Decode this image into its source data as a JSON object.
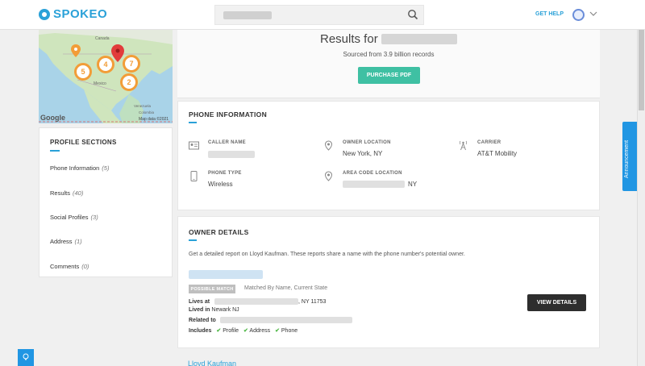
{
  "header": {
    "logo_text": "SPOKEO",
    "get_help_label": "GET HELP"
  },
  "map": {
    "attribution": "Map data ©2021",
    "google_label": "Google",
    "clusters": [
      {
        "label": "5",
        "color": "#f29d38"
      },
      {
        "label": "4",
        "color": "#f29d38"
      },
      {
        "label": "7",
        "color": "#f29d38"
      },
      {
        "label": "2",
        "color": "#f29d38"
      }
    ]
  },
  "sidebar": {
    "title": "PROFILE SECTIONS",
    "items": [
      {
        "label": "Phone Information",
        "count": "(5)"
      },
      {
        "label": "Results",
        "count": "(40)"
      },
      {
        "label": "Social Profiles",
        "count": "(3)"
      },
      {
        "label": "Address",
        "count": "(1)"
      },
      {
        "label": "Comments",
        "count": "(0)"
      }
    ]
  },
  "results": {
    "title_prefix": "Results for",
    "subtitle": "Sourced from 3.9 billion records",
    "purchase_label": "PURCHASE PDF"
  },
  "phone_info": {
    "title": "PHONE INFORMATION",
    "caller_name_label": "CALLER NAME",
    "owner_location_label": "OWNER LOCATION",
    "owner_location_value": "New York, NY",
    "carrier_label": "CARRIER",
    "carrier_value": "AT&T Mobility",
    "phone_type_label": "PHONE TYPE",
    "phone_type_value": "Wireless",
    "area_code_label": "AREA CODE LOCATION",
    "area_code_value": "NY"
  },
  "owner_details": {
    "title": "OWNER DETAILS",
    "description": "Get a detailed report on Lloyd Kaufman. These reports share a name with the phone number's potential owner.",
    "badge": "POSSIBLE MATCH",
    "match_text": "Matched By Name, Current State",
    "lives_at_label": "Lives at",
    "lives_at_suffix": ", NY 11753",
    "lived_in_label": "Lived in",
    "lived_in_value": "Newark NJ",
    "related_label": "Related to",
    "includes_label": "Includes",
    "includes": [
      "Profile",
      "Address",
      "Phone"
    ],
    "view_details_label": "VIEW DETAILS",
    "next_person": "Lloyd Kaufman"
  },
  "announcement_label": "Announcement"
}
